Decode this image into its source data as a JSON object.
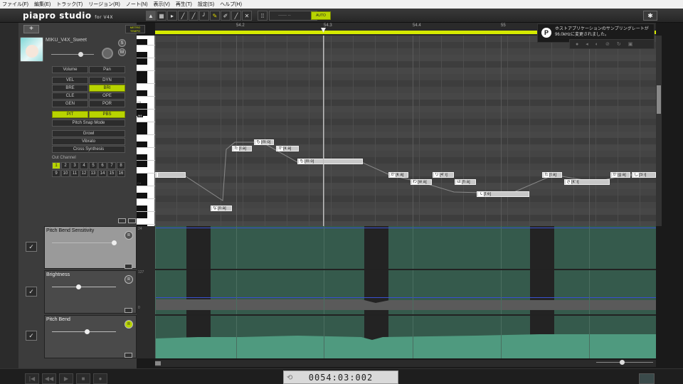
{
  "menu": [
    "ファイル(F)",
    "編集(E)",
    "トラック(T)",
    "リージョン(R)",
    "ノート(N)",
    "表示(V)",
    "再生(T)",
    "設定(S)",
    "ヘルプ(H)"
  ],
  "app": {
    "logo": "piapro studio",
    "logo_sub": "for V4X"
  },
  "toolbar": {
    "tools": [
      "▲",
      "▦",
      "▸",
      "╱",
      "╱",
      "╯",
      "✎",
      "✐",
      "╱",
      "✕"
    ],
    "quantize_value": "------ --",
    "auto_label": "AUTO",
    "settings_icon": "gear-icon"
  },
  "ruler": {
    "labels": [
      "54.2",
      "54.3",
      "54.4",
      "55"
    ]
  },
  "metronome_label": "METRO\nTEMPO",
  "track": {
    "add_label": "+",
    "name": "MIKU_V4X_Sweet",
    "solo": "S",
    "mute": "M"
  },
  "param_buttons": [
    {
      "label": "Volume",
      "on": false
    },
    {
      "label": "Pan",
      "on": false
    },
    {
      "label": "VEL",
      "on": false
    },
    {
      "label": "DYN",
      "on": false
    },
    {
      "label": "BRE",
      "on": false
    },
    {
      "label": "BRI",
      "on": true
    },
    {
      "label": "CLE",
      "on": false
    },
    {
      "label": "OPE",
      "on": false
    },
    {
      "label": "GEN",
      "on": false
    },
    {
      "label": "POR",
      "on": false
    },
    {
      "label": "PIT",
      "on": true
    },
    {
      "label": "PBS",
      "on": true
    }
  ],
  "wide_buttons": [
    "Pitch Snap Mode",
    "Growl",
    "Vibrato",
    "Cross Synthesis"
  ],
  "out_channel": {
    "label": "Out Channel",
    "channels": [
      "1",
      "2",
      "3",
      "4",
      "5",
      "6",
      "7",
      "8",
      "9",
      "10",
      "11",
      "12",
      "13",
      "14",
      "15",
      "16"
    ],
    "selected": "1"
  },
  "piano_labels": [
    "C5",
    "M4",
    "C4"
  ],
  "notes": [
    {
      "lyric": "も",
      "phon": "[m o]"
    },
    {
      "lyric": "た",
      "phon": "[t a]"
    },
    {
      "lyric": "か",
      "phon": "[k a]"
    },
    {
      "lyric": "も",
      "phon": "[m o]"
    },
    {
      "lyric": "",
      "phon": ""
    },
    {
      "lyric": "か",
      "phon": "[k a]"
    },
    {
      "lyric": "り",
      "phon": "[4' i]"
    },
    {
      "lyric": "わ",
      "phon": "[w a]"
    },
    {
      "lyric": "は",
      "phon": "[h a]"
    },
    {
      "lyric": "て",
      "phon": "[t e]"
    },
    {
      "lyric": "た",
      "phon": "[t a]"
    },
    {
      "lyric": "き",
      "phon": "[k' i]"
    },
    {
      "lyric": "が",
      "phon": "[g a]"
    },
    {
      "lyric": "し",
      "phon": "[S i]"
    },
    {
      "lyric": "な",
      "phon": "[n a]"
    }
  ],
  "notification": {
    "text_line1": "ホストアプリケーションのサンプリングレートが",
    "text_line2": "96.0kHzに変更されました。",
    "icon": "P"
  },
  "controls": [
    {
      "name": "Pitch Bend Sensitivity",
      "knob": "R",
      "active": true
    },
    {
      "name": "Brightness",
      "knob": "R",
      "active": false
    },
    {
      "name": "Pitch Bend",
      "knob": "R",
      "active": false
    }
  ],
  "ctrl_scale": [
    "24",
    "127",
    "0"
  ],
  "transport": {
    "time": "0054:03:002",
    "buttons": [
      "|◀",
      "◀◀",
      "▶",
      "■",
      "●"
    ]
  },
  "colors": {
    "accent": "#b8d400",
    "note": "#c8c8c8",
    "ctrl_fill": "#4f9a7f"
  }
}
